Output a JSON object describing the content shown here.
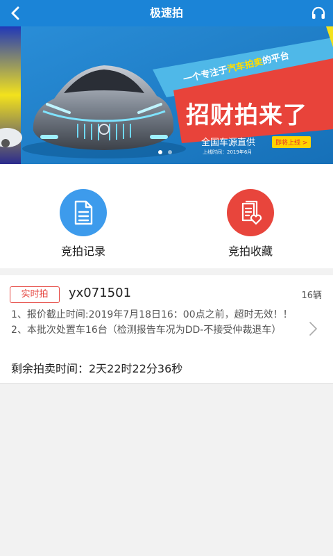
{
  "header": {
    "title": "极速拍",
    "back_icon": "chevron-left-icon",
    "support_icon": "headset-icon"
  },
  "banner": {
    "tagline_prefix": "一个专注于",
    "tagline_highlight": "汽车拍卖",
    "tagline_suffix": "的平台",
    "headline": "招财拍来了",
    "subline": "全国车源直供",
    "launch_date": "上线时间：2019年6月",
    "badge": "即将上线 >",
    "slides": 2,
    "active_slide": 1
  },
  "quick_actions": [
    {
      "label": "竞拍记录",
      "icon": "document-icon",
      "color": "#3d9bec"
    },
    {
      "label": "竞拍收藏",
      "icon": "favorite-docs-icon",
      "color": "#e8453c"
    }
  ],
  "auction": {
    "type_badge": "实时拍",
    "lot_id": "yx071501",
    "vehicle_count": "16辆",
    "description": "1、报价截止时间:2019年7月18日16：00点之前，超时无效！！2、本批次处置车16台（检测报告车况为DD-不接受仲裁退车）",
    "remaining": "剩余拍卖时间：2天22时22分36秒"
  },
  "colors": {
    "header_bg": "#1b84d7",
    "accent_red": "#e5453f",
    "accent_blue": "#3d9bec"
  }
}
